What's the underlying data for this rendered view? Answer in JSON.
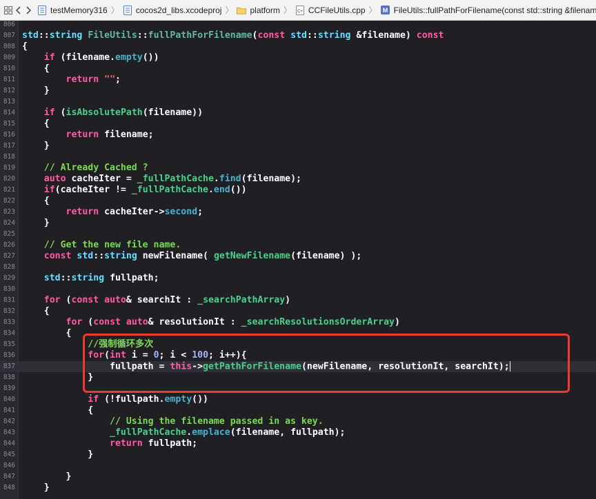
{
  "jumpbar": {
    "back_icon": "chevron-left-icon",
    "forward_icon": "chevron-right-icon",
    "grid_icon": "related-items-grid-icon",
    "crumbs": [
      {
        "label": "testMemory316",
        "icon": "xcode-project-icon"
      },
      {
        "label": "cocos2d_libs.xcodeproj",
        "icon": "xcode-project-icon"
      },
      {
        "label": "platform",
        "icon": "folder-icon"
      },
      {
        "label": "CCFileUtils.cpp",
        "icon": "cpp-file-icon"
      },
      {
        "label": "FileUtils::fullPathForFilename(const std::string &filename)",
        "icon": "method-m-icon"
      }
    ]
  },
  "editor": {
    "lines": [
      {
        "n": "806",
        "html": ""
      },
      {
        "n": "807",
        "html": "<span class=\"ty\">std</span>::<span class=\"ty\">string</span> <span class=\"fn\">FileUtils</span>::<span class=\"fn\">fullPathForFilename</span>(<span class=\"kw\">const</span> <span class=\"ty\">std</span>::<span class=\"ty\">string</span> &amp;filename) <span class=\"kw\">const</span>"
      },
      {
        "n": "808",
        "html": "{"
      },
      {
        "n": "809",
        "html": "    <span class=\"kw\">if</span> (filename.<span class=\"mem\">empty</span>())"
      },
      {
        "n": "810",
        "html": "    {"
      },
      {
        "n": "811",
        "html": "        <span class=\"kw\">return</span> <span class=\"st\">\"\"</span>;"
      },
      {
        "n": "812",
        "html": "    }"
      },
      {
        "n": "813",
        "html": ""
      },
      {
        "n": "814",
        "html": "    <span class=\"kw\">if</span> (<span class=\"iv\">isAbsolutePath</span>(filename))"
      },
      {
        "n": "815",
        "html": "    {"
      },
      {
        "n": "816",
        "html": "        <span class=\"kw\">return</span> filename;"
      },
      {
        "n": "817",
        "html": "    }"
      },
      {
        "n": "818",
        "html": ""
      },
      {
        "n": "819",
        "html": "    <span class=\"cm\">// Already Cached ?</span>"
      },
      {
        "n": "820",
        "html": "    <span class=\"kw\">auto</span> cacheIter = <span class=\"iv\">_fullPathCache</span>.<span class=\"mem\">find</span>(filename);"
      },
      {
        "n": "821",
        "html": "    <span class=\"kw\">if</span>(cacheIter != <span class=\"iv\">_fullPathCache</span>.<span class=\"mem\">end</span>())"
      },
      {
        "n": "822",
        "html": "    {"
      },
      {
        "n": "823",
        "html": "        <span class=\"kw\">return</span> cacheIter-&gt;<span class=\"mem\">second</span>;"
      },
      {
        "n": "824",
        "html": "    }"
      },
      {
        "n": "825",
        "html": ""
      },
      {
        "n": "826",
        "html": "    <span class=\"cm\">// Get the new file name.</span>"
      },
      {
        "n": "827",
        "html": "    <span class=\"kw\">const</span> <span class=\"ty\">std</span>::<span class=\"ty\">string</span> newFilename( <span class=\"iv\">getNewFilename</span>(filename) );"
      },
      {
        "n": "828",
        "html": ""
      },
      {
        "n": "829",
        "html": "    <span class=\"ty\">std</span>::<span class=\"ty\">string</span> fullpath;"
      },
      {
        "n": "830",
        "html": ""
      },
      {
        "n": "831",
        "html": "    <span class=\"kw\">for</span> (<span class=\"kw\">const</span> <span class=\"kw\">auto</span>&amp; searchIt : <span class=\"iv\">_searchPathArray</span>)"
      },
      {
        "n": "832",
        "html": "    {"
      },
      {
        "n": "833",
        "html": "        <span class=\"kw\">for</span> (<span class=\"kw\">const</span> <span class=\"kw\">auto</span>&amp; resolutionIt : <span class=\"iv\">_searchResolutionsOrderArray</span>)"
      },
      {
        "n": "834",
        "html": "        {"
      },
      {
        "n": "835",
        "html": "            <span class=\"cm\">//强制循环多次</span>"
      },
      {
        "n": "836",
        "html": "            <span class=\"kw\">for</span>(<span class=\"kw\">int</span> i = <span class=\"nm\">0</span>; i &lt; <span class=\"nm\">100</span>; i++){"
      },
      {
        "n": "837",
        "html": "                fullpath = <span class=\"kw\">this</span>-&gt;<span class=\"iv\">getPathForFilename</span>(newFilename, resolutionIt, searchIt);<span class=\"cursor\"></span>",
        "current": true
      },
      {
        "n": "838",
        "html": "            }"
      },
      {
        "n": "839",
        "html": ""
      },
      {
        "n": "840",
        "html": "            <span class=\"kw\">if</span> (!fullpath.<span class=\"mem\">empty</span>())"
      },
      {
        "n": "841",
        "html": "            {"
      },
      {
        "n": "842",
        "html": "                <span class=\"cm\">// Using the filename passed in as key.</span>"
      },
      {
        "n": "843",
        "html": "                <span class=\"iv\">_fullPathCache</span>.<span class=\"mem\">emplace</span>(filename, fullpath);"
      },
      {
        "n": "844",
        "html": "                <span class=\"kw\">return</span> fullpath;"
      },
      {
        "n": "845",
        "html": "            }"
      },
      {
        "n": "846",
        "html": ""
      },
      {
        "n": "847",
        "html": "        }"
      },
      {
        "n": "848",
        "html": "    }"
      }
    ]
  },
  "colors": {
    "keyword": "#fc5fa3",
    "type": "#6bdfff",
    "member": "#4eb0cc",
    "project_symbol": "#4fcf8b",
    "comment": "#7ed957",
    "string": "#fc6a5d",
    "number": "#a3b4ff",
    "annotation_box": "#ef3b2d"
  }
}
